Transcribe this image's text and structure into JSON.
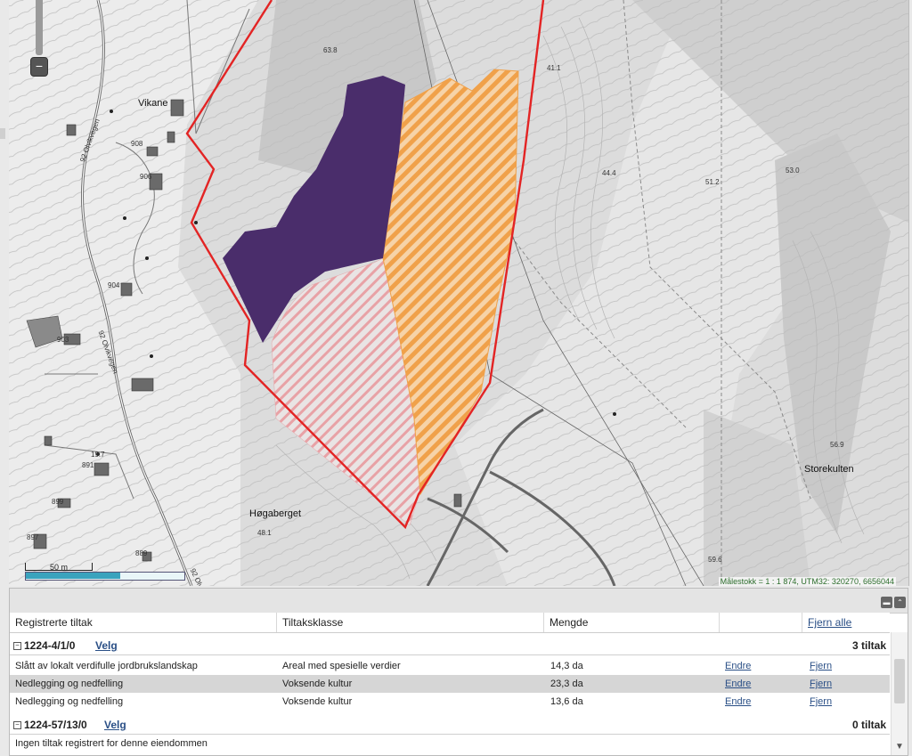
{
  "map": {
    "places": {
      "vikane": "Vikane",
      "hogaberget": "Høgaberget",
      "storekulten": "Storekulten"
    },
    "spot_heights": {
      "h638": "63.8",
      "h411": "41.1",
      "h444": "44.4",
      "h512": "51.2",
      "h530": "53.0",
      "h569": "56.9",
      "h481": "48.1",
      "h596": "59.6",
      "h197": "19.7"
    },
    "buildings": {
      "b908": "908",
      "b906": "906",
      "b904": "904",
      "b903": "903",
      "b891": "891",
      "b899": "899",
      "b897": "897",
      "b889": "889"
    },
    "roads": {
      "r1": "92 Olvikvegen",
      "r2": "92 Olvikvegen",
      "r3": "92 Olv"
    },
    "scale_label": "50 m",
    "scale_info": "Målestokk = 1 : 1 874, UTM32: 320270, 6656044",
    "colors": {
      "boundary": "#e32424",
      "dark_area": "#4a2d6b",
      "orange_hatch": "#f0a14a",
      "pink_hatch": "#e8a2a6"
    }
  },
  "panel": {
    "headers": {
      "registrerte": "Registrerte tiltak",
      "tiltaksklasse": "Tiltaksklasse",
      "mengde": "Mengde",
      "fjern_alle": "Fjern alle"
    },
    "groups": [
      {
        "id": "1224-4/1/0",
        "velg": "Velg",
        "count": "3 tiltak",
        "rows": [
          {
            "tiltak": "Slått av lokalt verdifulle jordbrukslandskap",
            "klasse": "Areal med spesielle verdier",
            "mengde": "14,3 da",
            "endre": "Endre",
            "fjern": "Fjern"
          },
          {
            "tiltak": "Nedlegging og nedfelling",
            "klasse": "Voksende kultur",
            "mengde": "23,3 da",
            "endre": "Endre",
            "fjern": "Fjern"
          },
          {
            "tiltak": "Nedlegging og nedfelling",
            "klasse": "Voksende kultur",
            "mengde": "13,6 da",
            "endre": "Endre",
            "fjern": "Fjern"
          }
        ]
      },
      {
        "id": "1224-57/13/0",
        "velg": "Velg",
        "count": "0 tiltak",
        "empty": "Ingen tiltak registrert for denne eiendommen"
      }
    ]
  }
}
